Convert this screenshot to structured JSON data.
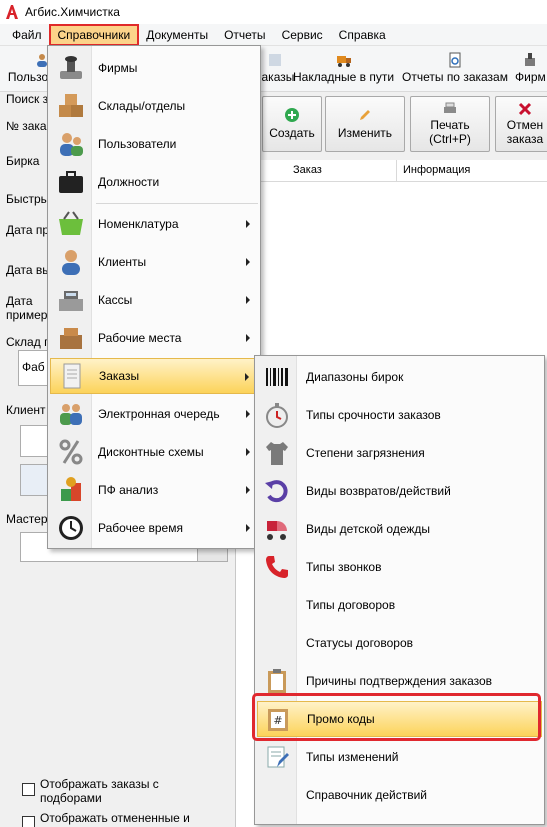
{
  "window": {
    "title": "Агбис.Химчистка"
  },
  "menubar": {
    "items": [
      "Файл",
      "Справочники",
      "Документы",
      "Отчеты",
      "Сервис",
      "Справка"
    ]
  },
  "toolbar": {
    "items": [
      {
        "label": "Пользо",
        "icon": "users-icon"
      },
      {
        "label": "заказы",
        "icon": "orders-icon"
      },
      {
        "label": "Накладные в пути",
        "icon": "truck-icon"
      },
      {
        "label": "Отчеты по заказам",
        "icon": "report-icon"
      },
      {
        "label": "Фирм",
        "icon": "firms-icon"
      }
    ]
  },
  "left_panel": {
    "search_label": "Поиск з",
    "order_no_label": "№ зака",
    "tag_label": "Бирка",
    "quick_label": "Быстры",
    "date_received_label": "Дата пр",
    "date_issued_label": "Дата вы",
    "date_fitting_label_1": "Дата",
    "date_fitting_label_2": "пример",
    "warehouse_label": "Склад п",
    "warehouse_value": "Фаб",
    "client_label": "Клиент",
    "master_label": "Мастер",
    "checkbox_1_label_1": "Отображать заказы с",
    "checkbox_1_label_2": "подборами",
    "checkbox_2_label": "Отображать отмененные и"
  },
  "right_panel": {
    "buttons": {
      "create": "Создать",
      "edit": "Изменить",
      "print_1": "Печать",
      "print_2": "(Ctrl+P)",
      "cancel_1": "Отмен",
      "cancel_2": "заказа"
    },
    "grid_headers": [
      "Заказ",
      "Информация"
    ]
  },
  "dropdown": {
    "items": [
      {
        "label": "Фирмы",
        "icon": "stamp-icon",
        "submenu": false
      },
      {
        "label": "Склады/отделы",
        "icon": "boxes-icon",
        "submenu": false
      },
      {
        "label": "Пользователи",
        "icon": "users-icon",
        "submenu": false
      },
      {
        "label": "Должности",
        "icon": "briefcase-icon",
        "submenu": false
      },
      {
        "label": "Номенклатура",
        "icon": "basket-icon",
        "submenu": true
      },
      {
        "label": "Клиенты",
        "icon": "client-icon",
        "submenu": true
      },
      {
        "label": "Кассы",
        "icon": "cash-register-icon",
        "submenu": true
      },
      {
        "label": "Рабочие места",
        "icon": "workplace-icon",
        "submenu": true
      },
      {
        "label": "Заказы",
        "icon": "scroll-icon",
        "submenu": true
      },
      {
        "label": "Электронная очередь",
        "icon": "queue-icon",
        "submenu": true
      },
      {
        "label": "Дисконтные схемы",
        "icon": "percent-icon",
        "submenu": true
      },
      {
        "label": "ПФ анализ",
        "icon": "analysis-icon",
        "submenu": true
      },
      {
        "label": "Рабочее время",
        "icon": "clock-icon",
        "submenu": true
      }
    ]
  },
  "submenu": {
    "items": [
      {
        "label": "Диапазоны бирок",
        "icon": "barcode-icon"
      },
      {
        "label": "Типы срочности заказов",
        "icon": "stopwatch-icon"
      },
      {
        "label": "Степени загрязнения",
        "icon": "shirt-icon"
      },
      {
        "label": "Виды возвратов/действий",
        "icon": "return-icon"
      },
      {
        "label": "Виды детской одежды",
        "icon": "stroller-icon"
      },
      {
        "label": "Типы звонков",
        "icon": "phone-icon"
      },
      {
        "label": "Типы договоров",
        "icon": ""
      },
      {
        "label": "Статусы договоров",
        "icon": ""
      },
      {
        "label": "Причины подтверждения заказов",
        "icon": "clipboard-icon"
      },
      {
        "label": "Промо коды",
        "icon": "promo-code-icon"
      },
      {
        "label": "Типы изменений",
        "icon": "edit-list-icon"
      },
      {
        "label": "Справочник действий",
        "icon": ""
      }
    ]
  },
  "colors": {
    "highlight": "#fcd35a",
    "menu_active": "#fcd38a",
    "callout": "#e0282f",
    "plus": "#2fa84f",
    "cancel_x": "#c8102e"
  }
}
